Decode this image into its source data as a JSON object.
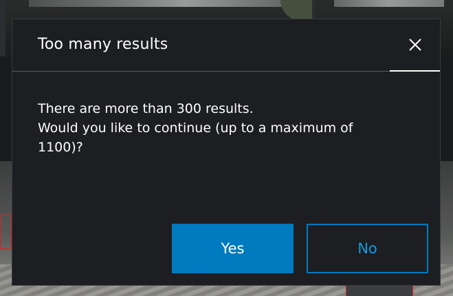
{
  "dialog": {
    "title": "Too many results",
    "close_icon": "close-icon",
    "message_lines": [
      "There are more than 300 results.",
      "Would you like to continue (up to a maximum of",
      "1100)?"
    ],
    "yes_label": "Yes",
    "no_label": "No"
  },
  "colors": {
    "dialog_background": "#1d1e21",
    "primary_button": "#007bc0",
    "secondary_button_text": "#139ae0",
    "detection_box": "#e0201a"
  }
}
